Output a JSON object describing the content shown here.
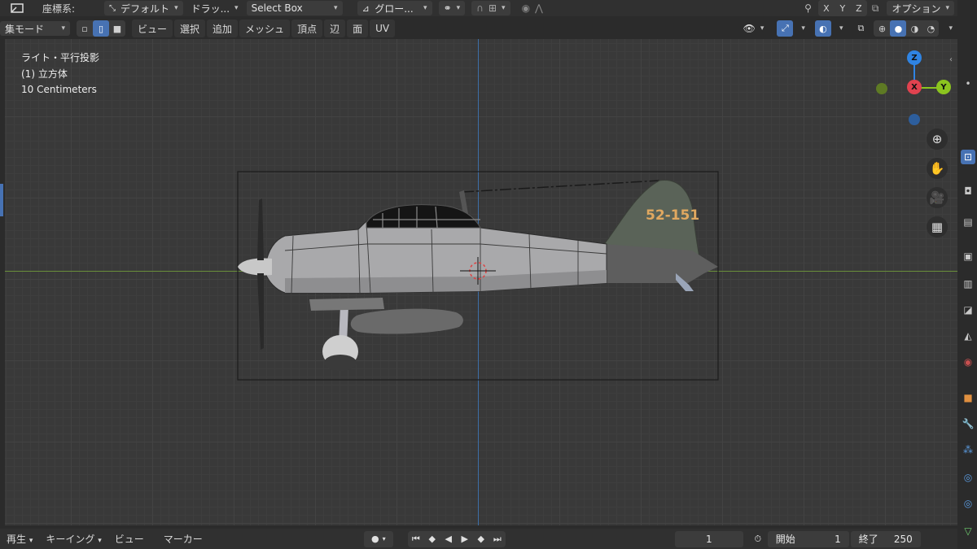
{
  "header": {
    "coord_label": "座標系:",
    "coord_value": "デフォルト",
    "drag_label": "ドラッ...",
    "select_mode": "Select Box",
    "orientation": "グロー...",
    "axes": [
      "X",
      "Y",
      "Z"
    ],
    "options": "オプション"
  },
  "toolbar": {
    "mode": "集モード",
    "menus": [
      "ビュー",
      "選択",
      "追加",
      "メッシュ",
      "頂点",
      "辺",
      "面",
      "UV"
    ]
  },
  "viewport": {
    "overlay_line1": "ライト・平行投影",
    "overlay_line2": "(1) 立方体",
    "overlay_line3": "10 Centimeters",
    "tail_marking": "52-151",
    "gizmo": {
      "z": "Z",
      "x": "X",
      "y": "Y"
    }
  },
  "timeline": {
    "playback": "再生",
    "keying": "キーイング",
    "view": "ビュー",
    "marker": "マーカー",
    "current_frame": "1",
    "start_label": "開始",
    "start_value": "1",
    "end_label": "終了",
    "end_value": "250"
  },
  "colors": {
    "accent": "#4772b3",
    "axis_x": "#e0424f",
    "axis_y": "#8bc41f",
    "axis_z": "#2f84e3"
  }
}
